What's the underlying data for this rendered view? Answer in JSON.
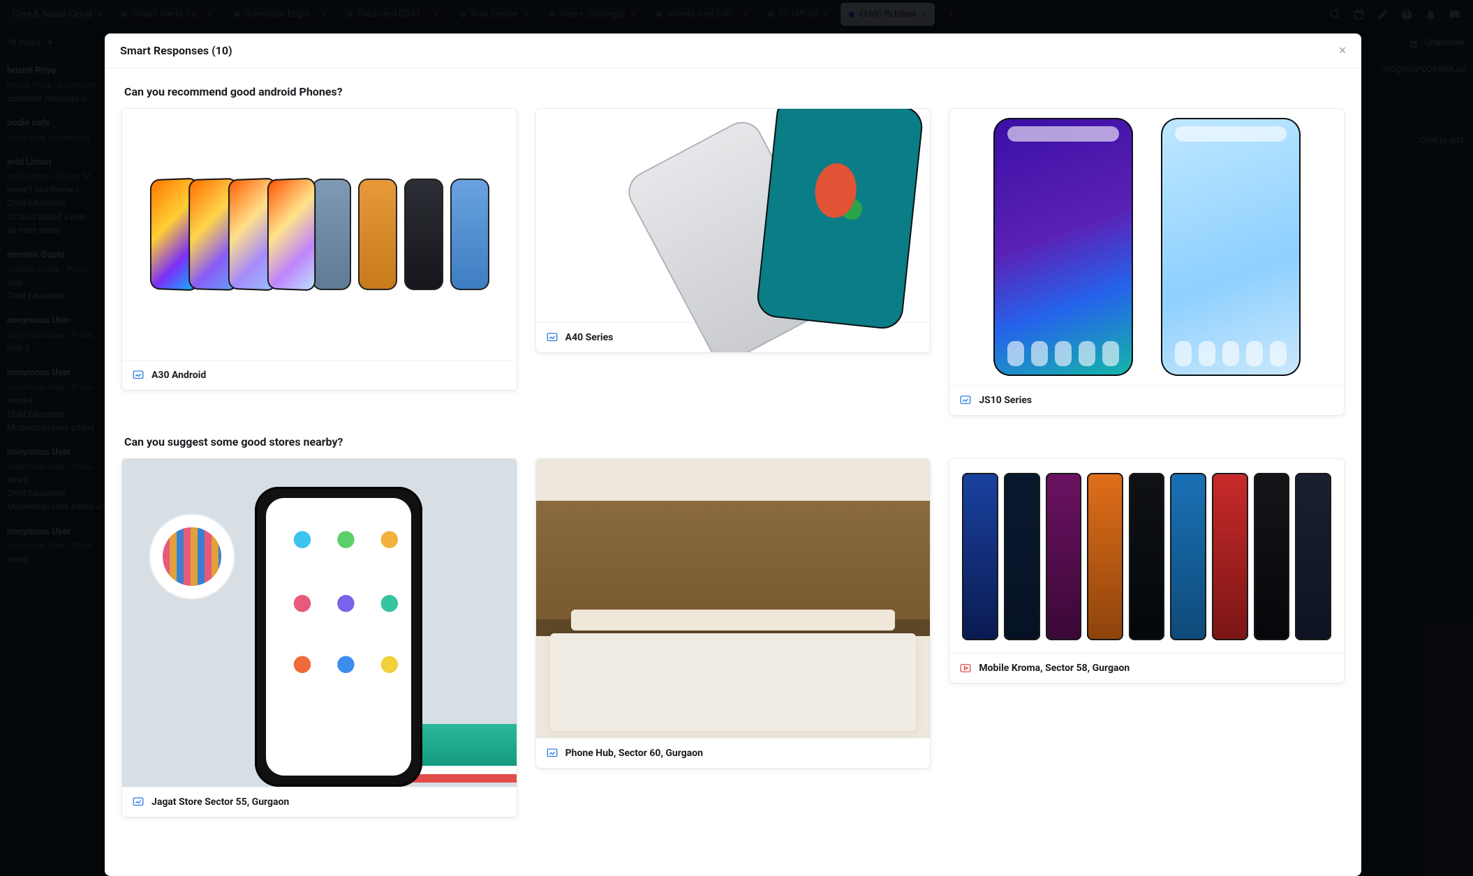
{
  "brand": {
    "name": "Core & Social Cloud"
  },
  "tabs": [
    {
      "label": "Smart Alerts Co…",
      "active": false
    },
    {
      "label": "Scheduler Engin…",
      "active": false
    },
    {
      "label": "Predicted CSAT …",
      "active": false
    },
    {
      "label": "Rule Engine",
      "active": false
    },
    {
      "label": "Users (Settings)",
      "active": false
    },
    {
      "label": "Intents And Enti…",
      "active": false
    },
    {
      "label": "(3.1M) all",
      "active": false
    },
    {
      "label": "(169) fb inbox",
      "active": true
    }
  ],
  "subbar": {
    "left": "fb inbox",
    "right": "Unarchive"
  },
  "right_meta": "Click to add",
  "right_hash": "OcDgnl/oPQD8WMLprl",
  "left_list": [
    {
      "title": "hrishti Priya",
      "meta": "hrishti Priya • Comment",
      "sub": "comment response c…"
    },
    {
      "title": "oodie cafe",
      "meta": "oodie cafe • Comment"
    },
    {
      "title": "avid Limon",
      "meta": "avid Limon • Private M…",
      "sub": "heme1 and theme3",
      "notes": [
        "Child Education",
        "CS Acid added a note",
        "all more notes"
      ]
    },
    {
      "title": "evenish Gupta",
      "meta": "evenish Gupta • Privat…",
      "sub": "eply",
      "notes": [
        "Child Education"
      ]
    },
    {
      "title": "nonymous User",
      "meta": "nonymous User • Priva…",
      "sub": "itish 5"
    },
    {
      "title": "nonymous User",
      "meta": "nonymous User • Priva…",
      "sub": "heme4",
      "notes": [
        "Child Education",
        "Moderation User added"
      ]
    },
    {
      "title": "nonymous User",
      "meta": "nonymous User • Priva…",
      "sub": "eme2",
      "notes": [
        "Child Education",
        "Moderation User added a tag"
      ]
    },
    {
      "title": "nonymous User",
      "meta": "nonymous User • Priva…",
      "sub": "eme2"
    }
  ],
  "modal": {
    "title": "Smart Responses (10)",
    "sections": [
      {
        "title": "Can you recommend good android Phones?",
        "cards": [
          {
            "label": "A30 Android",
            "icon": "image",
            "img": "a30"
          },
          {
            "label": "A40 Series",
            "icon": "image",
            "img": "a40"
          },
          {
            "label": "JS10 Series",
            "icon": "image",
            "img": "js10"
          }
        ]
      },
      {
        "title": "Can you suggest some good stores nearby?",
        "cards": [
          {
            "label": "Jagat Store Sector 55, Gurgaon",
            "icon": "image",
            "img": "jagat"
          },
          {
            "label": "Phone Hub, Sector 60, Gurgaon",
            "icon": "image",
            "img": "hub"
          },
          {
            "label": "Mobile Kroma, Sector 58, Gurgaon",
            "icon": "video",
            "img": "kroma"
          }
        ]
      }
    ]
  }
}
